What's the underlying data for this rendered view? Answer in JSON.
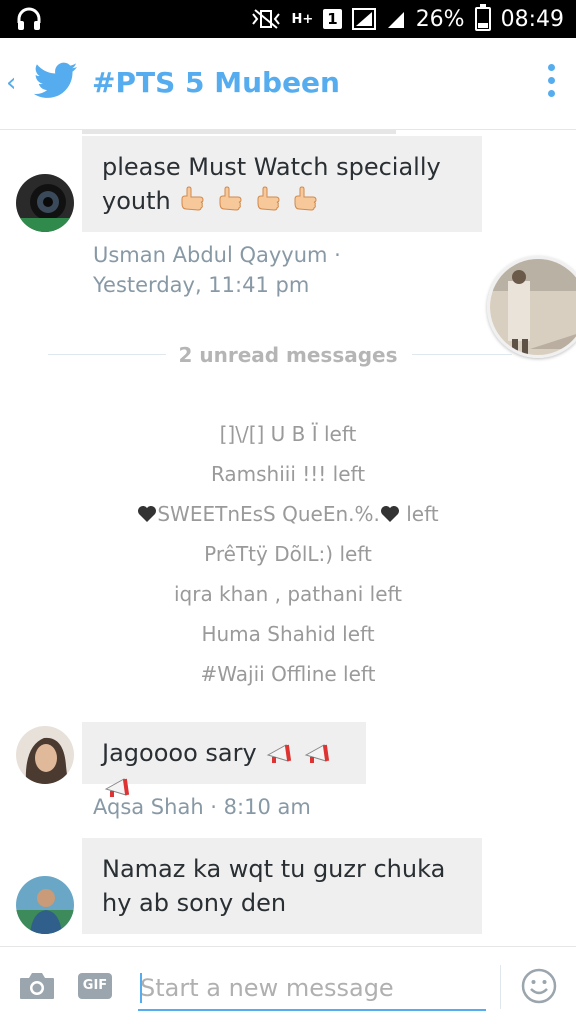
{
  "status_bar": {
    "battery": "26%",
    "battery_level": 0.26,
    "time": "08:49",
    "sim_badge": "1",
    "network": "H+"
  },
  "header": {
    "title": "#PTS 5 Mubeen",
    "accent_color": "#55acee"
  },
  "messages": [
    {
      "text": "please Must Watch specially youth",
      "emoji_count": 4,
      "meta": "Usman Abdul Qayyum · Yesterday, 11:41 pm"
    },
    {
      "text": "Jagoooo sary",
      "emoji_count": 3,
      "meta": "Aqsa Shah · 8:10 am"
    },
    {
      "text": "Namaz ka wqt tu guzr chuka hy ab sony den"
    }
  ],
  "unread_divider": "2 unread messages",
  "left_events": [
    "[]\\/[] U B Ï left",
    "Ramshiii !!! left",
    "SWEETnEsS QueEn.%.",
    "left",
    "PrêTtÿ DõlL:) left",
    "iqra khan , pathani left",
    "Huma Shahid left",
    "#Wajii Offline left"
  ],
  "composer": {
    "placeholder": "Start a new message",
    "gif_label": "GIF"
  }
}
